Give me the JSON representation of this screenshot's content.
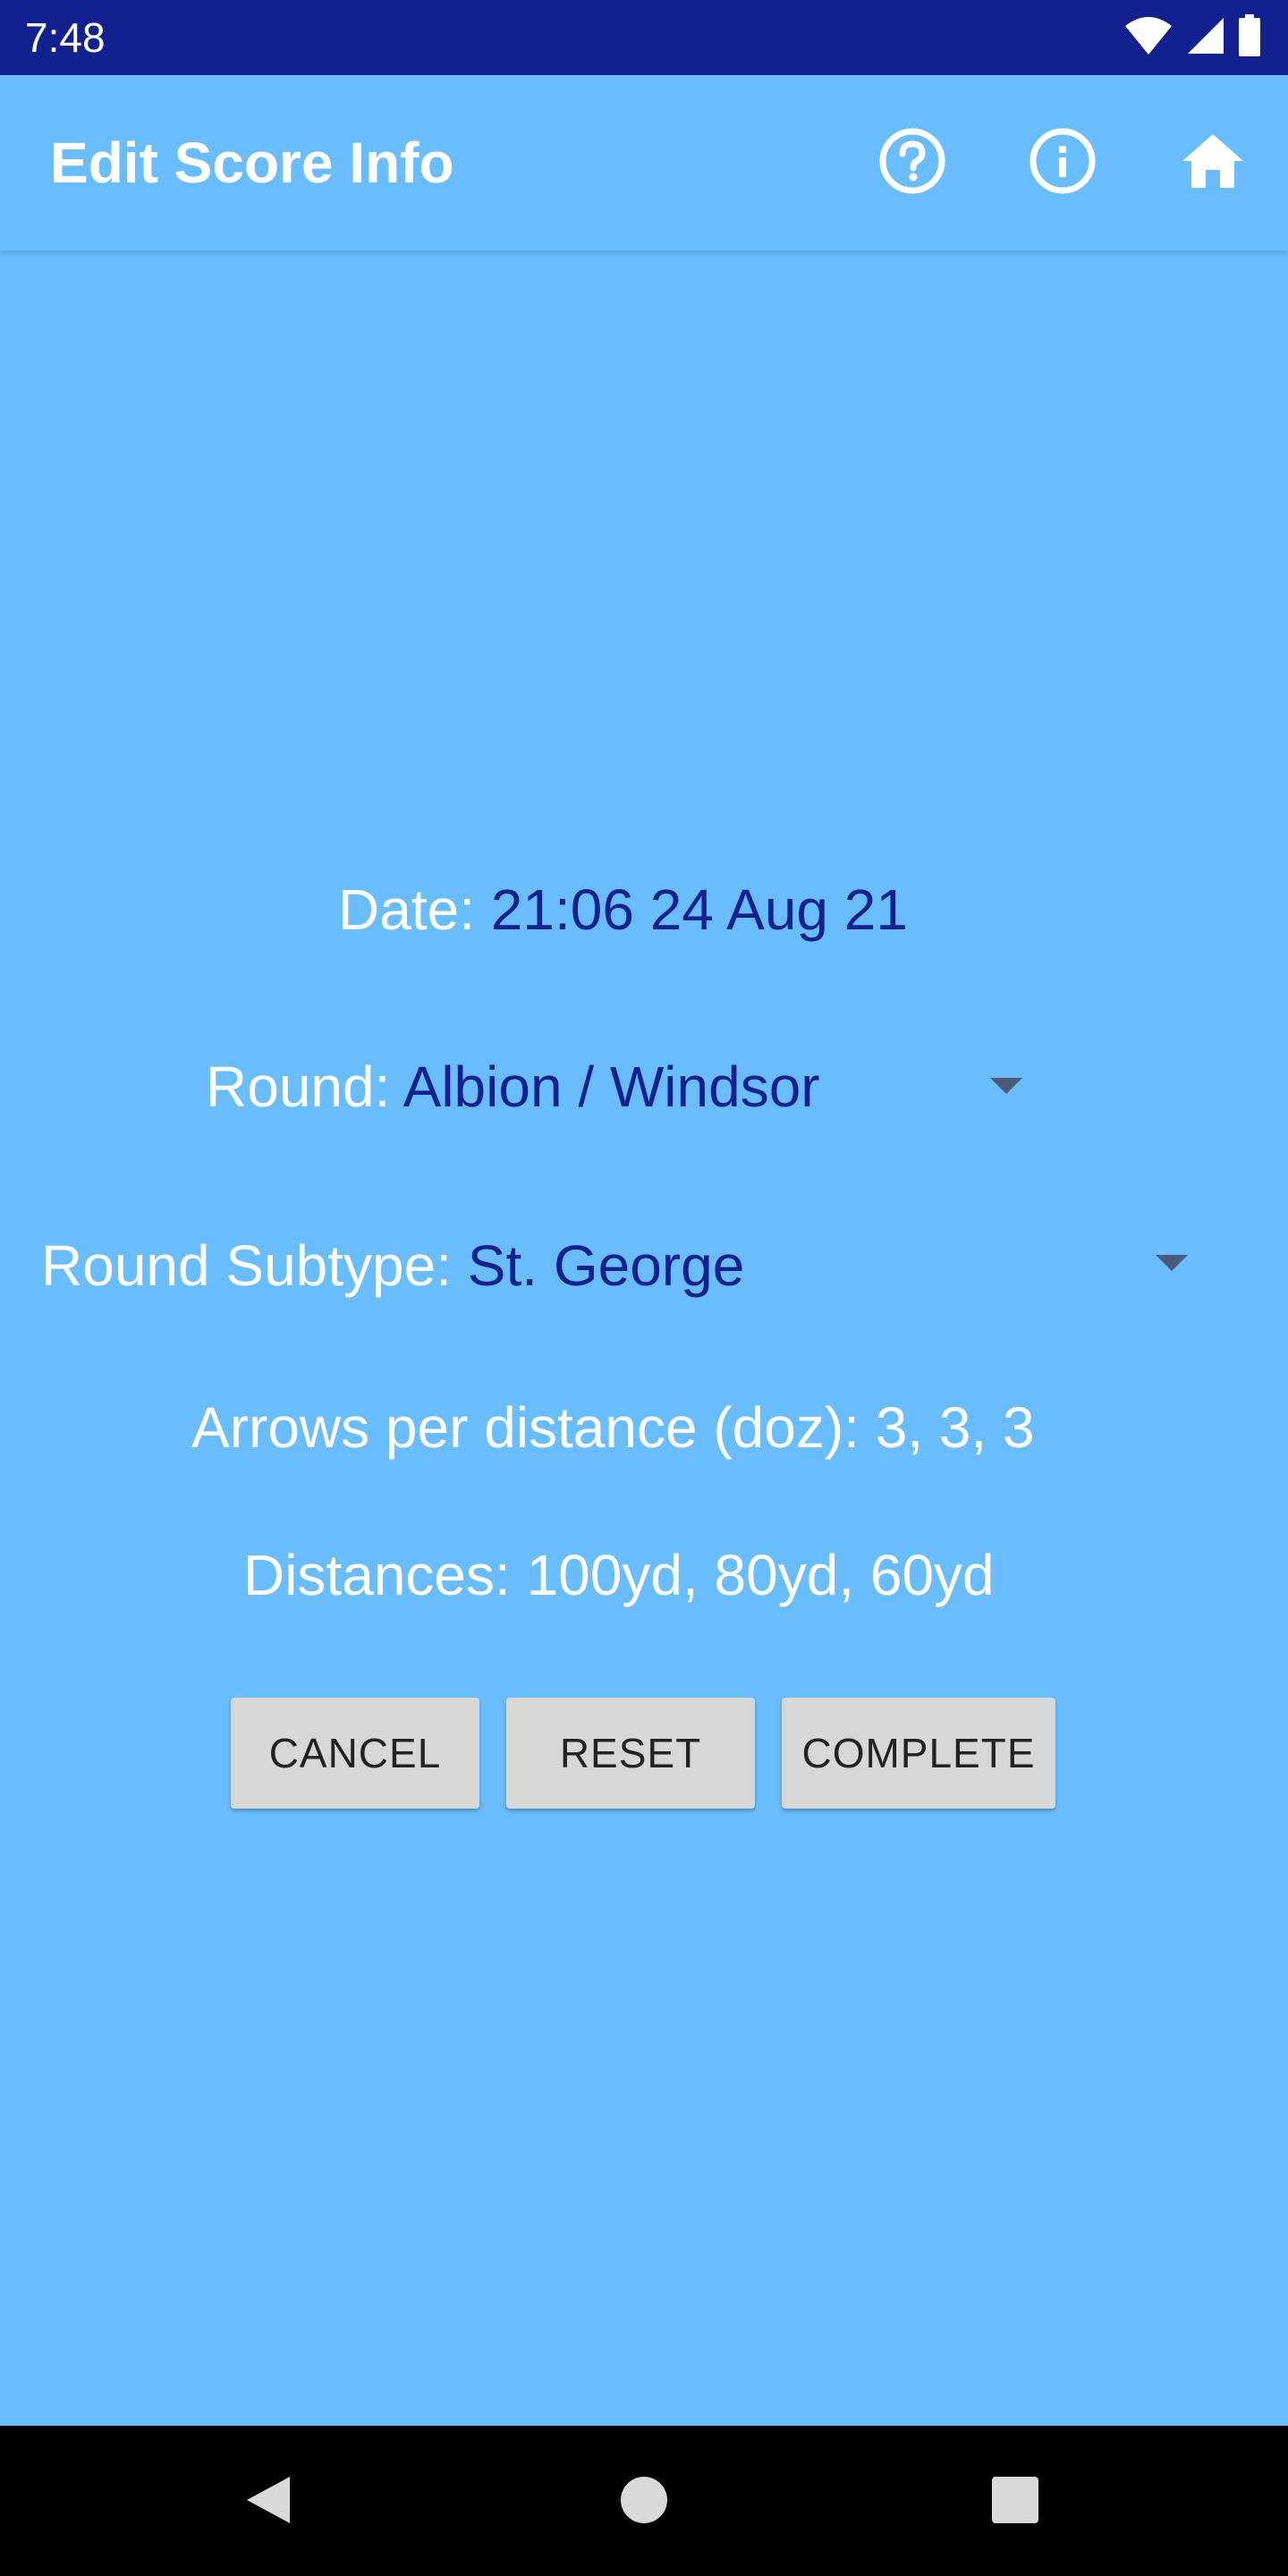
{
  "status_bar": {
    "time": "7:48",
    "icons": [
      "wifi-icon",
      "signal-icon",
      "battery-icon"
    ]
  },
  "app_bar": {
    "title": "Edit Score Info",
    "actions": [
      "help-icon",
      "info-icon",
      "home-icon"
    ]
  },
  "form": {
    "date": {
      "label": "Date: ",
      "value": "21:06 24 Aug 21"
    },
    "round": {
      "label": "Round: ",
      "value": "Albion / Windsor"
    },
    "round_subtype": {
      "label": "Round Subtype: ",
      "value": "St. George"
    },
    "arrows": {
      "text": "Arrows per distance (doz): 3, 3, 3"
    },
    "distances": {
      "text": "Distances: 100yd, 80yd, 60yd"
    }
  },
  "buttons": {
    "cancel": "CANCEL",
    "reset": "RESET",
    "complete": "COMPLETE"
  },
  "nav_bar": {
    "buttons": [
      "back-icon",
      "home-circle-icon",
      "recents-icon"
    ]
  },
  "colors": {
    "status_bar": "#13218f",
    "background": "#6abdfd",
    "value_text": "#13218f",
    "label_text": "#ffffff",
    "button_bg": "#d7d7d7"
  }
}
